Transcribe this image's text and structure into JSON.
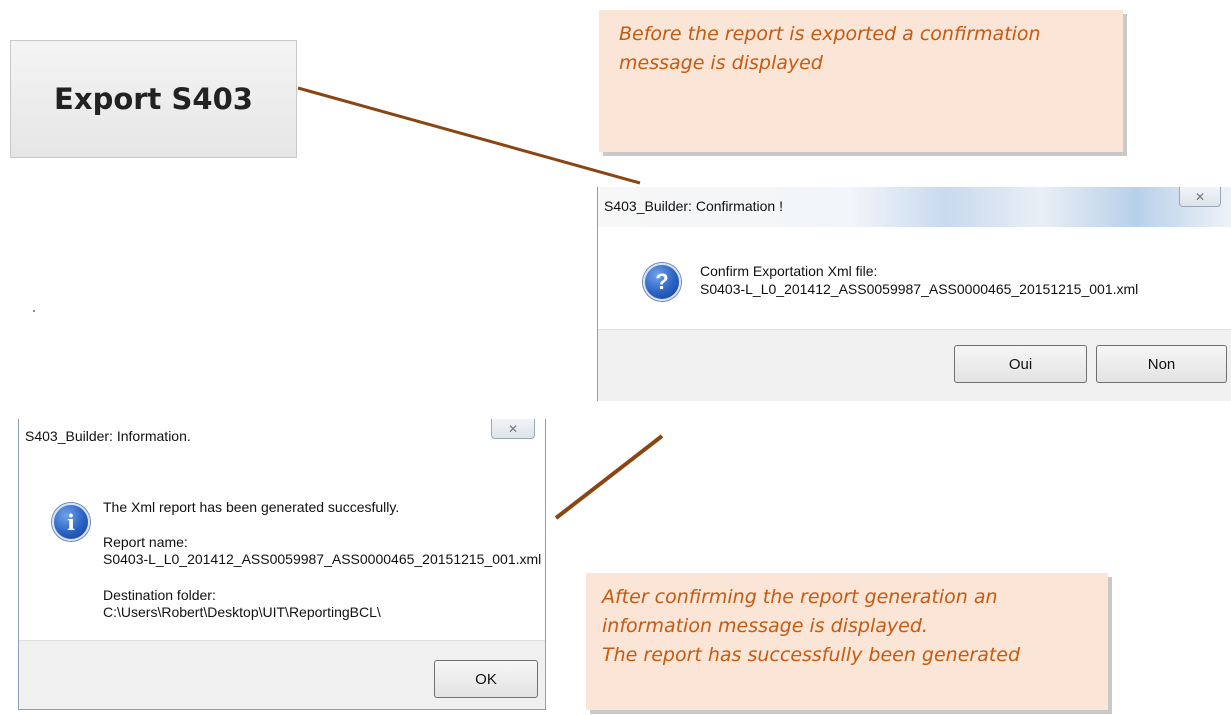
{
  "export_button": {
    "label": "Export S403"
  },
  "notes": {
    "top": {
      "lines": [
        "Before the report is exported a confirmation",
        "message is displayed"
      ]
    },
    "bottom": {
      "lines": [
        "After confirming the report generation an",
        "information message is displayed.",
        "The report has successfully been generated"
      ]
    }
  },
  "confirm_dialog": {
    "title": "S403_Builder: Confirmation !",
    "close_glyph": "✕",
    "icon": "question-icon",
    "icon_glyph": "?",
    "message_line1": "Confirm Exportation Xml file:",
    "message_line2": "S0403-L_L0_201412_ASS0059987_ASS0000465_20151215_001.xml",
    "yes_label": "Oui",
    "no_label": "Non"
  },
  "info_dialog": {
    "title": "S403_Builder: Information.",
    "close_glyph": "✕",
    "icon": "information-icon",
    "icon_glyph": "i",
    "line1": "The Xml report has been  generated succesfully.",
    "report_label": "Report name:",
    "report_name": "S0403-L_L0_201412_ASS0059987_ASS0000465_20151215_001.xml",
    "destination_label": "Destination folder:",
    "destination_path": "C:\\Users\\Robert\\Desktop\\UIT\\ReportingBCL\\",
    "ok_label": "OK"
  },
  "colors": {
    "note_background": "#fbe5d6",
    "note_text": "#c55a11",
    "connector": "#8b4513"
  }
}
